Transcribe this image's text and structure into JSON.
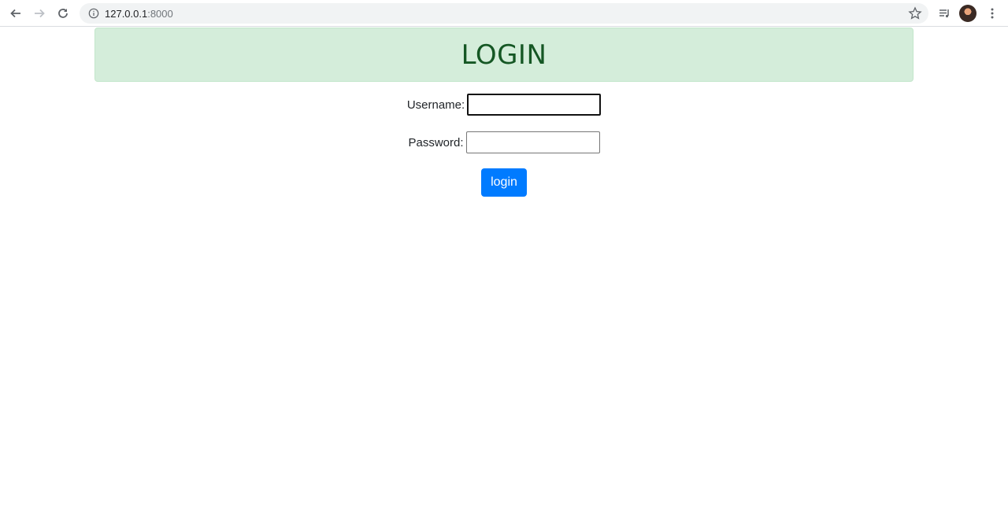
{
  "browser": {
    "url_host": "127.0.0.1",
    "url_port": ":8000"
  },
  "page": {
    "heading": "LOGIN",
    "username_label": "Username:",
    "username_value": "",
    "password_label": "Password:",
    "password_value": "",
    "login_button": "login"
  },
  "colors": {
    "banner_bg": "#d4edda",
    "banner_text": "#155724",
    "button_bg": "#007bff"
  }
}
